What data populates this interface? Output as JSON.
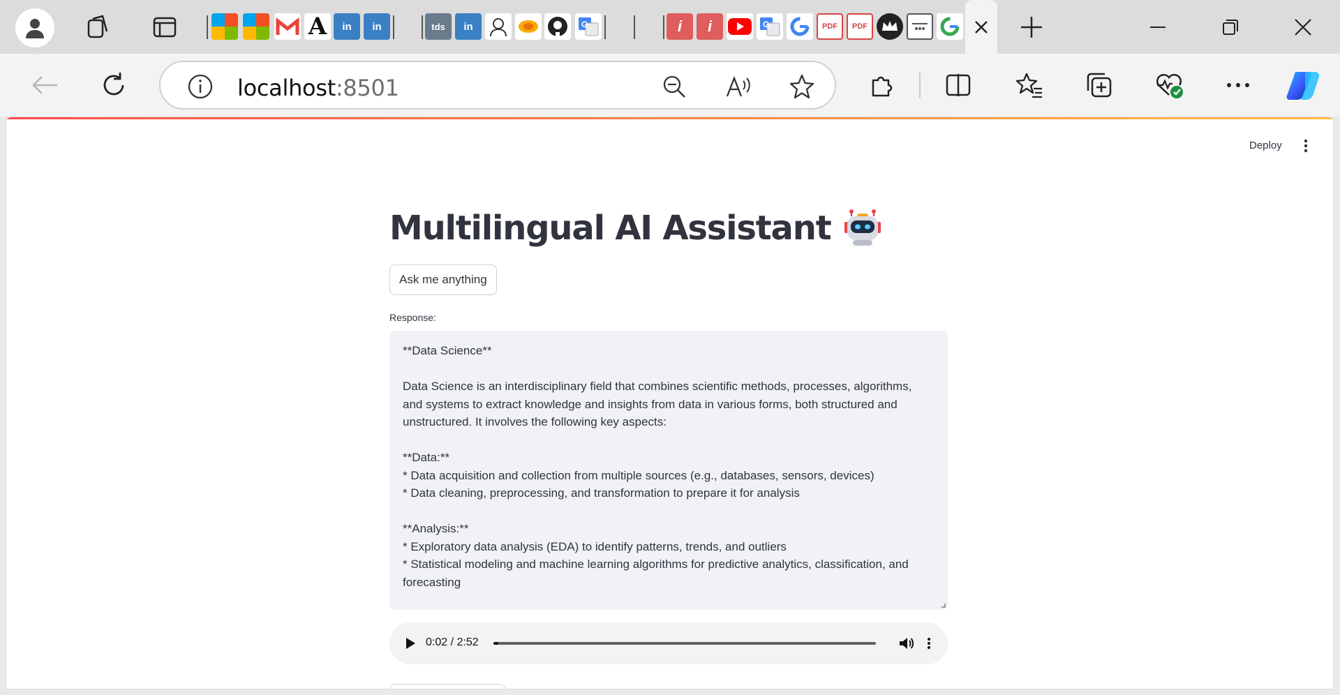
{
  "browser": {
    "address_bar": {
      "host": "localhost",
      "port": ":8501"
    },
    "favicons": [
      "microsoft-icon",
      "microsoft-icon",
      "gmail-icon",
      "a-icon",
      "linkedin-icon",
      "linkedin-icon",
      "tds-icon",
      "linkedin-icon",
      "portrait-icon",
      "colab-icon",
      "github-icon",
      "translate-icon",
      "pdf-reader-icon",
      "pdf-reader-icon",
      "youtube-icon",
      "translate-icon",
      "google-icon",
      "pdf-icon",
      "pdf-icon",
      "crown-icon",
      "app-icon",
      "google-icon"
    ],
    "tds_label": "tds"
  },
  "app": {
    "toolbar": {
      "deploy_label": "Deploy"
    },
    "title": "Multilingual AI Assistant",
    "title_emoji": "robot-icon",
    "ask_button_label": "Ask me anything",
    "response_label": "Response:",
    "response_text": "**Data Science**\n\nData Science is an interdisciplinary field that combines scientific methods, processes, algorithms, and systems to extract knowledge and insights from data in various forms, both structured and unstructured. It involves the following key aspects:\n\n**Data:**\n* Data acquisition and collection from multiple sources (e.g., databases, sensors, devices)\n* Data cleaning, preprocessing, and transformation to prepare it for analysis\n\n**Analysis:**\n* Exploratory data analysis (EDA) to identify patterns, trends, and outliers\n* Statistical modeling and machine learning algorithms for predictive analytics, classification, and forecasting",
    "audio": {
      "time": "0:02 / 2:52",
      "progress_fraction": 0.012
    }
  },
  "colors": {
    "accent_start": "#ff4b4b",
    "accent_end": "#ffbd45",
    "text": "#31333f",
    "response_bg": "#f0f2f6"
  }
}
